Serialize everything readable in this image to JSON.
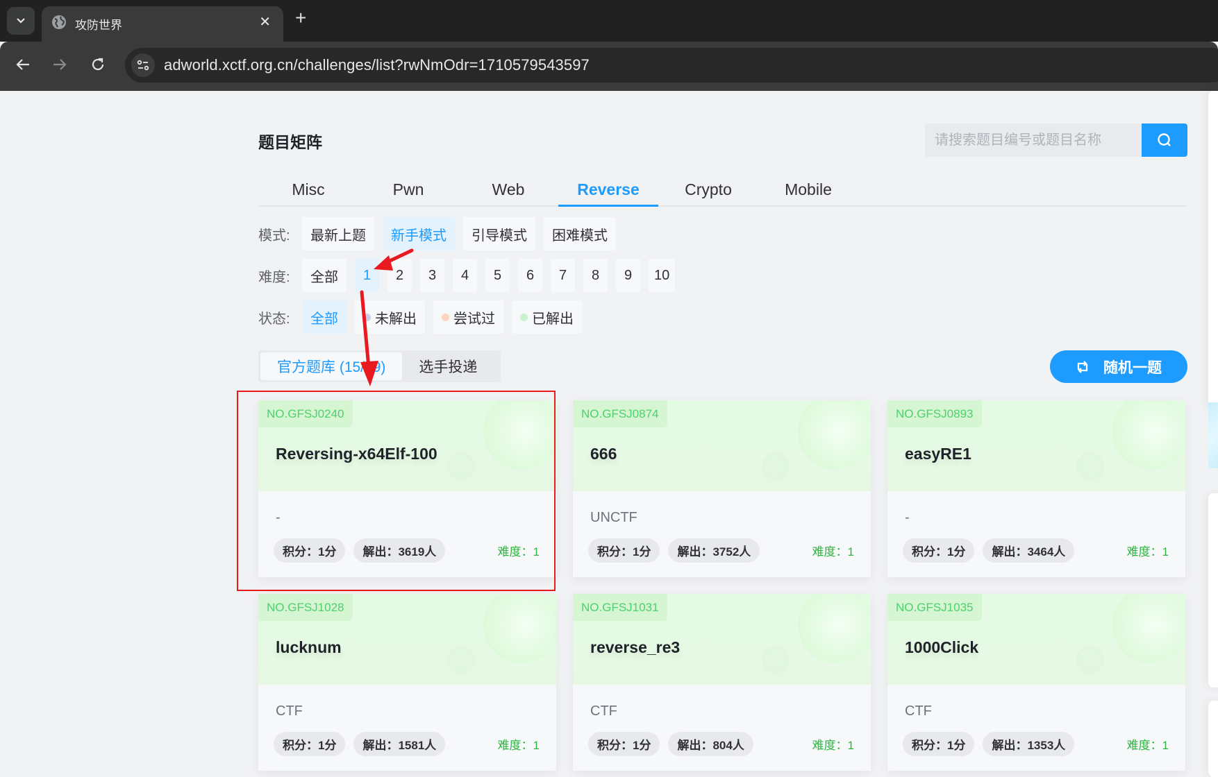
{
  "browser": {
    "tab_title": "攻防世界",
    "url": "adworld.xctf.org.cn/challenges/list?rwNmOdr=1710579543597",
    "icons": {
      "tab_search": "chevron-down-icon",
      "favicon": "globe-icon",
      "close": "close-icon",
      "new_tab": "plus-icon",
      "back": "arrow-left-icon",
      "forward": "arrow-right-icon",
      "reload": "reload-icon",
      "site_info": "tune-icon"
    }
  },
  "page": {
    "title": "题目矩阵",
    "search": {
      "placeholder": "请搜索题目编号或题目名称",
      "value": "",
      "icon": "search-icon"
    },
    "categories": [
      {
        "label": "Misc",
        "active": false
      },
      {
        "label": "Pwn",
        "active": false
      },
      {
        "label": "Web",
        "active": false
      },
      {
        "label": "Reverse",
        "active": true
      },
      {
        "label": "Crypto",
        "active": false
      },
      {
        "label": "Mobile",
        "active": false
      }
    ],
    "mode": {
      "label": "模式:",
      "options": [
        {
          "label": "最新上题",
          "active": false
        },
        {
          "label": "新手模式",
          "active": true
        },
        {
          "label": "引导模式",
          "active": false
        },
        {
          "label": "困难模式",
          "active": false
        }
      ]
    },
    "difficulty": {
      "label": "难度:",
      "options": [
        {
          "label": "全部",
          "active": false
        },
        {
          "label": "1",
          "active": true
        },
        {
          "label": "2",
          "active": false
        },
        {
          "label": "3",
          "active": false
        },
        {
          "label": "4",
          "active": false
        },
        {
          "label": "5",
          "active": false
        },
        {
          "label": "6",
          "active": false
        },
        {
          "label": "7",
          "active": false
        },
        {
          "label": "8",
          "active": false
        },
        {
          "label": "9",
          "active": false
        },
        {
          "label": "10",
          "active": false
        }
      ]
    },
    "status": {
      "label": "状态:",
      "options": [
        {
          "label": "全部",
          "active": true,
          "dot": null
        },
        {
          "label": "未解出",
          "active": false,
          "dot": "#c9cfe6"
        },
        {
          "label": "尝试过",
          "active": false,
          "dot": "#fbd5c0"
        },
        {
          "label": "已解出",
          "active": false,
          "dot": "#c8f3cb"
        }
      ]
    },
    "source_tabs": [
      {
        "label": "官方题库 (15/79)",
        "active": true
      },
      {
        "label": "选手投递",
        "active": false
      }
    ],
    "random_button": {
      "label": "随机一题",
      "icon": "shuffle-icon"
    },
    "colors": {
      "accent": "#1e9bff",
      "difficulty_text": "#2fb340",
      "card_no": "#4cd16b",
      "annotation": "#e8191f"
    }
  },
  "cards": [
    {
      "no": "NO.GFSJ0240",
      "title": "Reversing-x64Elf-100",
      "desc": "-",
      "score": "积分：1分",
      "solved": "解出：3619人",
      "difficulty": "难度：1"
    },
    {
      "no": "NO.GFSJ0874",
      "title": "666",
      "desc": "UNCTF",
      "score": "积分：1分",
      "solved": "解出：3752人",
      "difficulty": "难度：1"
    },
    {
      "no": "NO.GFSJ0893",
      "title": "easyRE1",
      "desc": "-",
      "score": "积分：1分",
      "solved": "解出：3464人",
      "difficulty": "难度：1"
    },
    {
      "no": "NO.GFSJ1028",
      "title": "lucknum",
      "desc": "CTF",
      "score": "积分：1分",
      "solved": "解出：1581人",
      "difficulty": "难度：1"
    },
    {
      "no": "NO.GFSJ1031",
      "title": "reverse_re3",
      "desc": "CTF",
      "score": "积分：1分",
      "solved": "解出：804人",
      "difficulty": "难度：1"
    },
    {
      "no": "NO.GFSJ1035",
      "title": "1000Click",
      "desc": "CTF",
      "score": "积分：1分",
      "solved": "解出：1353人",
      "difficulty": "难度：1"
    }
  ]
}
